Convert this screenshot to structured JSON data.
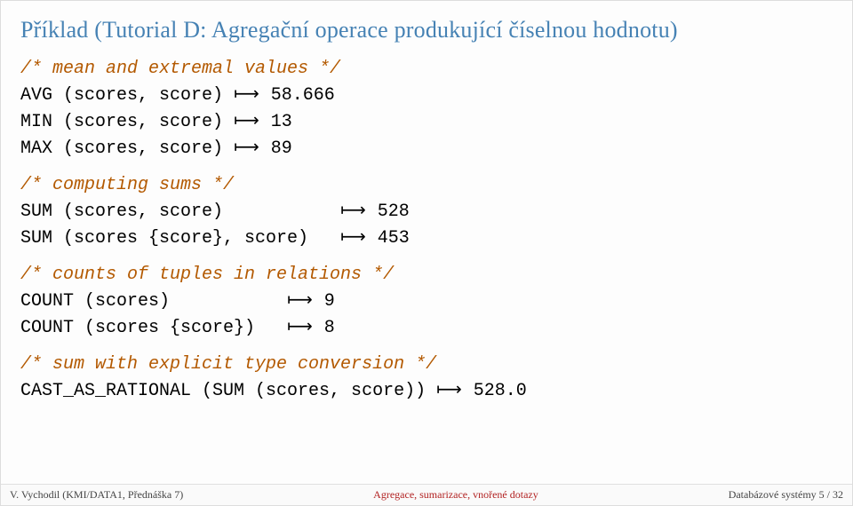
{
  "title": "Příklad (Tutorial D: Agregační operace produkující číselnou hodnotu)",
  "c1": "/* mean and extremal values */",
  "l1a": "AVG (scores, score)",
  "l1b": " 58.666",
  "l2a": "MIN (scores, score)",
  "l2b": " 13",
  "l3a": "MAX (scores, score)",
  "l3b": " 89",
  "c2": "/* computing sums */",
  "l4a": "SUM (scores, score)          ",
  "l4b": " 528",
  "l5a": "SUM (scores {score}, score)  ",
  "l5b": " 453",
  "c3": "/* counts of tuples in relations */",
  "l6a": "COUNT (scores)          ",
  "l6b": " 9",
  "l7a": "COUNT (scores {score})  ",
  "l7b": " 8",
  "c4": "/* sum with explicit type conversion */",
  "l8a": "CAST_AS_RATIONAL (SUM (scores, score))",
  "l8b": " 528.0",
  "evalArrow": "⟼",
  "footer": {
    "left": "V. Vychodil (KMI/DATA1, Přednáška 7)",
    "center": "Agregace, sumarizace, vnořené dotazy",
    "right": "Databázové systémy     5 / 32"
  }
}
